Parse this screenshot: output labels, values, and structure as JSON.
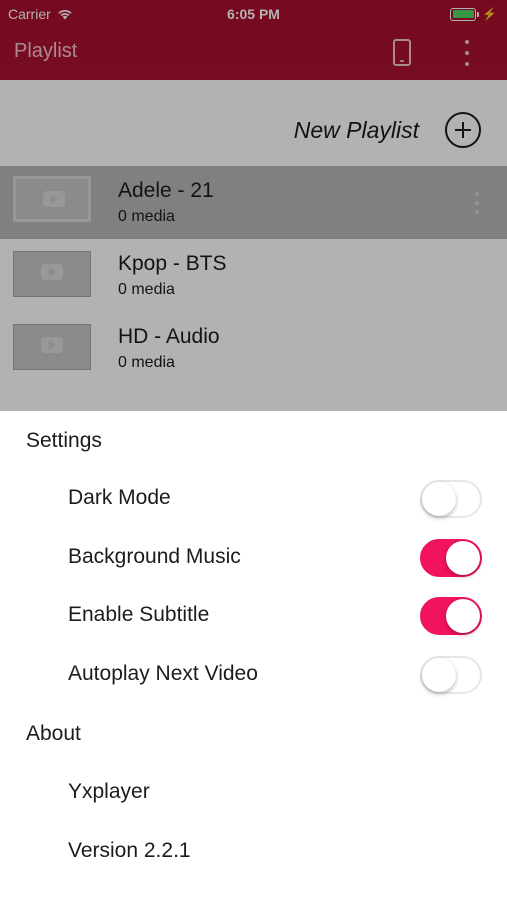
{
  "status_bar": {
    "carrier": "Carrier",
    "time": "6:05 PM"
  },
  "nav": {
    "title": "Playlist",
    "device_icon": "phone-icon",
    "more_icon": "more-vertical-icon"
  },
  "new_playlist": {
    "label": "New Playlist",
    "icon": "add-circle-icon"
  },
  "playlists": [
    {
      "name": "Adele - 21",
      "count": "0 media",
      "selected": true
    },
    {
      "name": "Kpop - BTS",
      "count": "0 media",
      "selected": false
    },
    {
      "name": "HD - Audio",
      "count": "0 media",
      "selected": false
    }
  ],
  "settings": {
    "title": "Settings",
    "items": [
      {
        "label": "Dark Mode",
        "on": false
      },
      {
        "label": "Background Music",
        "on": true
      },
      {
        "label": "Enable Subtitle",
        "on": true
      },
      {
        "label": "Autoplay Next Video",
        "on": false
      }
    ]
  },
  "about": {
    "title": "About",
    "items": [
      {
        "label": "Yxplayer"
      },
      {
        "label": "Version 2.2.1"
      }
    ]
  },
  "colors": {
    "header": "#a80d2d",
    "toggle_on": "#f1135e",
    "battery": "#4cd964"
  }
}
